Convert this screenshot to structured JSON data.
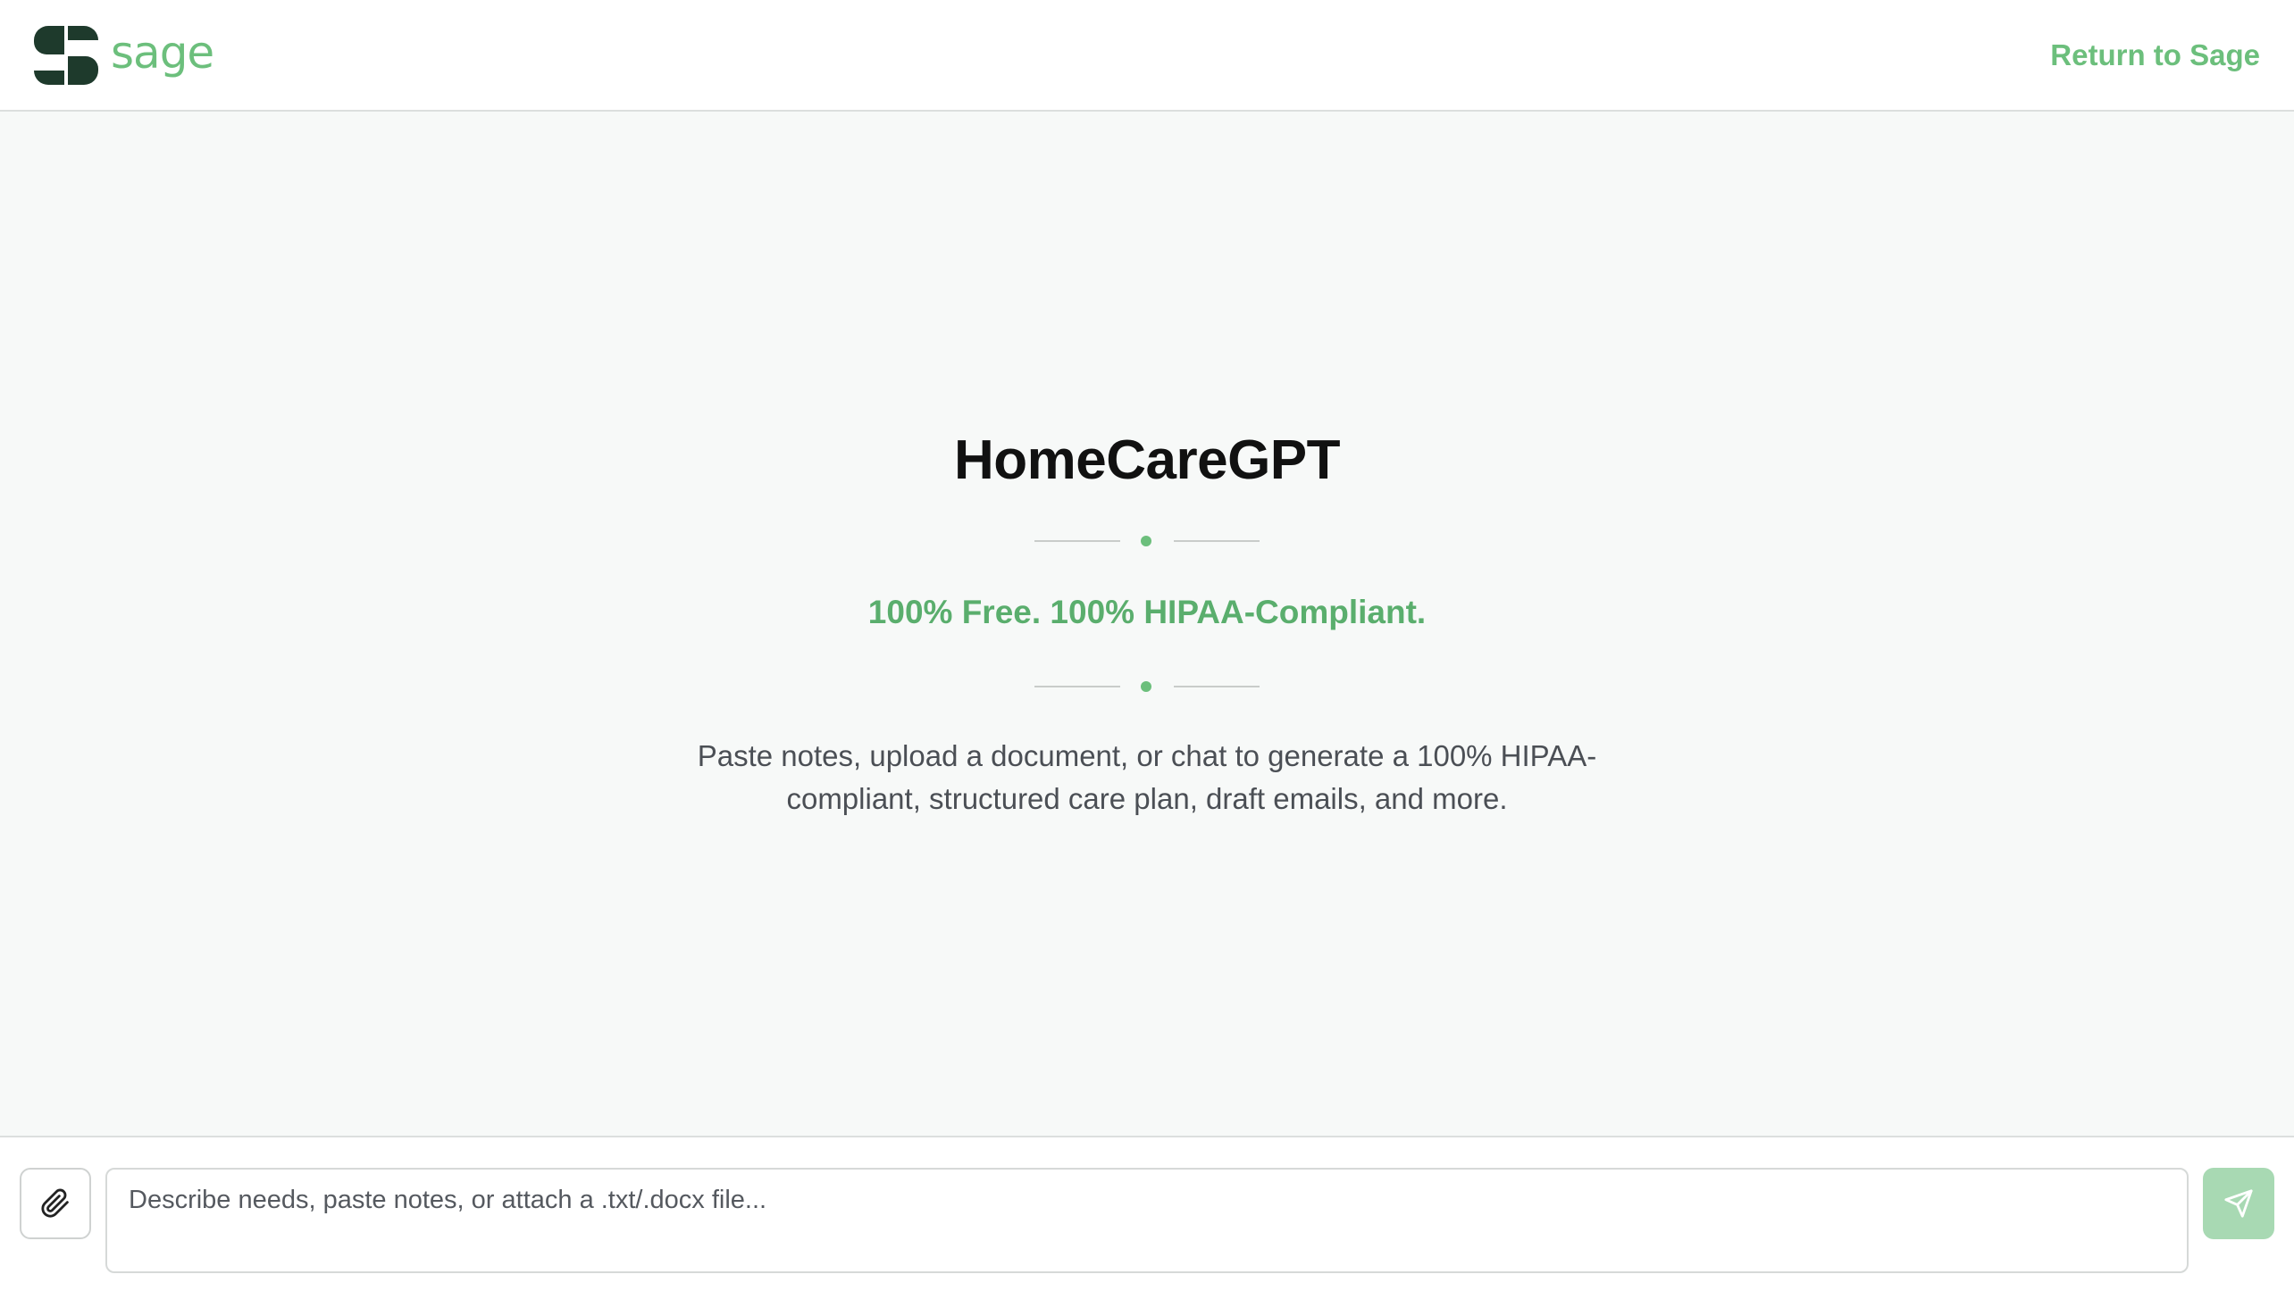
{
  "header": {
    "brand_name": "sage",
    "return_link": "Return to Sage"
  },
  "hero": {
    "title": "HomeCareGPT",
    "tagline": "100% Free. 100% HIPAA-Compliant.",
    "description": "Paste notes, upload a document, or chat to generate a 100% HIPAA-compliant, structured care plan, draft emails, and more."
  },
  "composer": {
    "input_value": "",
    "input_placeholder": "Describe needs, paste notes, or attach a .txt/.docx file...",
    "attach_icon": "paperclip-icon",
    "send_icon": "send-icon"
  },
  "colors": {
    "accent": "#6cbf7c",
    "brand_dark": "#1e3a2c",
    "background": "#f7f9f8",
    "send_button": "#a8d9b3"
  }
}
